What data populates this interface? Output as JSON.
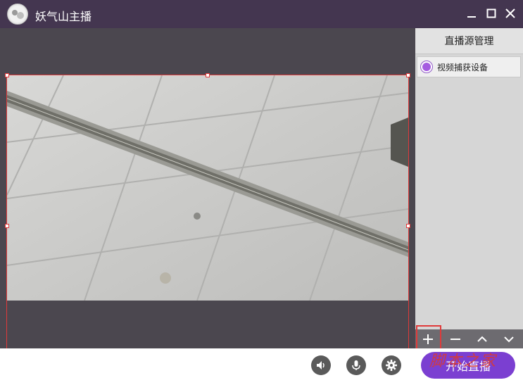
{
  "window": {
    "title": "妖气山主播",
    "controls": [
      "minimize-icon",
      "maximize-icon",
      "close-icon"
    ]
  },
  "side_panel": {
    "header": "直播源管理",
    "sources": [
      {
        "label": "视频捕获设备",
        "selected": true
      }
    ],
    "toolbar": {
      "add": "+",
      "remove": "−",
      "up": "︿",
      "down": "﹀"
    }
  },
  "bottom_bar": {
    "icons": [
      "speaker-icon",
      "microphone-icon",
      "settings-gear-icon"
    ],
    "start_label": "开始直播"
  },
  "watermark": {
    "text": "脚本之家"
  },
  "colors": {
    "titlebar": "#443650",
    "accent": "#7b3fd1",
    "highlight": "#e03a3a"
  }
}
